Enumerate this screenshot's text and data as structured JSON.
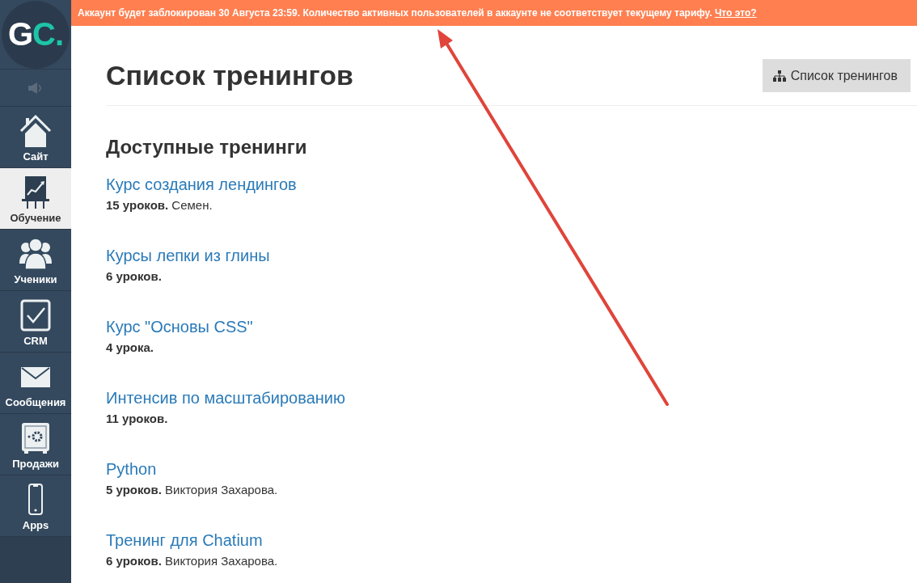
{
  "sidebar": {
    "logo": {
      "text": "G",
      "accent": "C."
    },
    "items": [
      {
        "label": "Сайт",
        "selected": false
      },
      {
        "label": "Обучение",
        "selected": true
      },
      {
        "label": "Ученики",
        "selected": false
      },
      {
        "label": "CRM",
        "selected": false
      },
      {
        "label": "Сообщения",
        "selected": false
      },
      {
        "label": "Продажи",
        "selected": false
      },
      {
        "label": "Apps",
        "selected": false
      }
    ]
  },
  "banner": {
    "text": "Аккаунт будет заблокирован 30 Августа 23:59. Количество активных пользователей в аккаунте не соответствует текущему тарифу.",
    "link": "Что это?"
  },
  "header": {
    "title": "Список тренингов",
    "button": "Список тренингов"
  },
  "section": {
    "title": "Доступные тренинги",
    "courses": [
      {
        "title": "Курс создания лендингов",
        "lessons": "15 уроков.",
        "author": "Семен."
      },
      {
        "title": "Курсы лепки из глины",
        "lessons": "6 уроков."
      },
      {
        "title": "Курс \"Основы CSS\"",
        "lessons": "4 урока."
      },
      {
        "title": "Интенсив по масштабированию",
        "lessons": "11 уроков."
      },
      {
        "title": "Python",
        "lessons": "5 уроков.",
        "author": "Виктория Захарова."
      },
      {
        "title": "Тренинг для Chatium",
        "lessons": "6 уроков.",
        "author": "Виктория Захарова."
      }
    ]
  },
  "annotation": {
    "kind": "arrow"
  }
}
